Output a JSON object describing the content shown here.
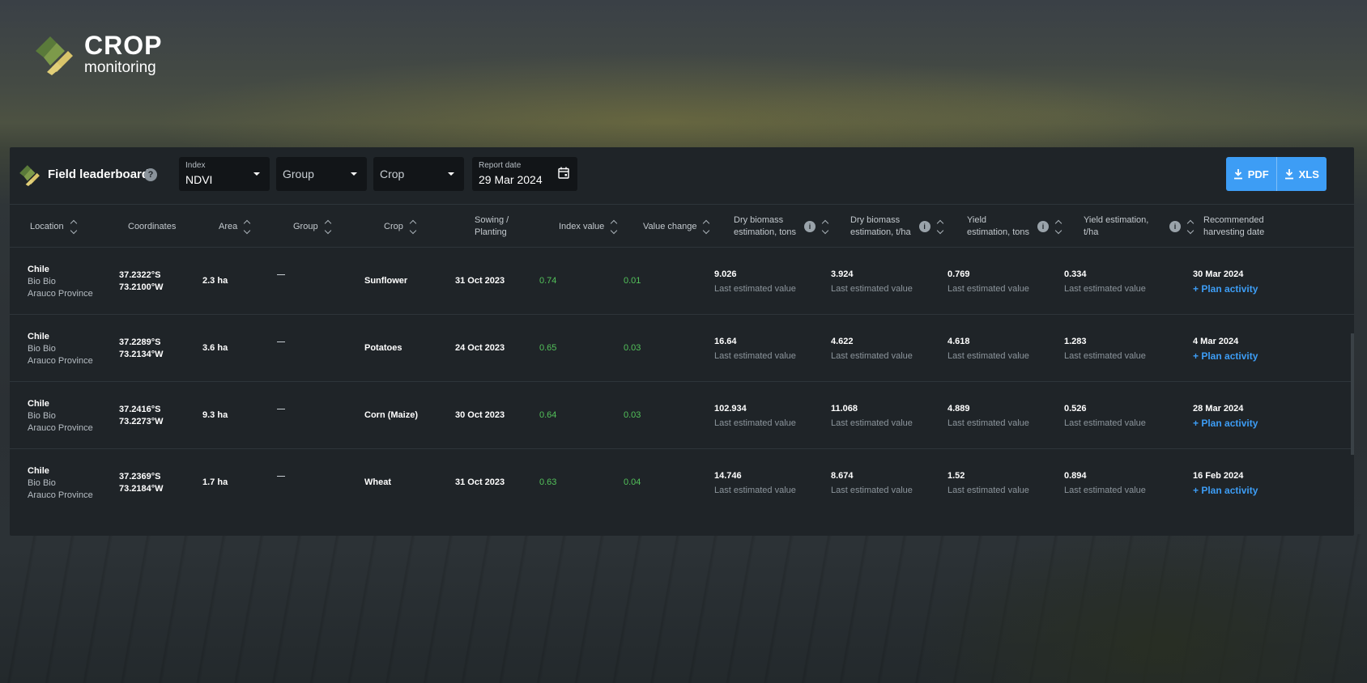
{
  "brand": {
    "title": "CROP",
    "subtitle": "monitoring"
  },
  "toolbar": {
    "title": "Field leaderboard",
    "help": "?",
    "index": {
      "label": "Index",
      "value": "NDVI"
    },
    "group": {
      "placeholder": "Group"
    },
    "crop": {
      "placeholder": "Crop"
    },
    "report_date": {
      "label": "Report date",
      "value": "29 Mar 2024"
    },
    "pdf_label": "PDF",
    "xls_label": "XLS"
  },
  "columns": {
    "location": "Location",
    "coordinates": "Coordinates",
    "area": "Area",
    "group": "Group",
    "crop": "Crop",
    "sowing_1": "Sowing /",
    "sowing_2": "Planting",
    "index_value": "Index value",
    "value_change": "Value change",
    "dry_tons_1": "Dry biomass",
    "dry_tons_2": "estimation, tons",
    "dry_tha_1": "Dry biomass",
    "dry_tha_2": "estimation, t/ha",
    "yield_tons_1": "Yield",
    "yield_tons_2": "estimation, tons",
    "yield_tha_1": "Yield estimation,",
    "yield_tha_2": "t/ha",
    "rec_1": "Recommended",
    "rec_2": "harvesting date"
  },
  "est_note": "Last estimated value",
  "plan_label": "+ Plan activity",
  "rows": [
    {
      "country": "Chile",
      "region": "Bio Bio",
      "province": "Arauco Province",
      "lat": "37.2322°S",
      "lon": "73.2100°W",
      "area": "2.3 ha",
      "crop": "Sunflower",
      "sowing": "31 Oct 2023",
      "index": "0.74",
      "change": "0.01",
      "dry_tons": "9.026",
      "dry_tha": "3.924",
      "yield_tons": "0.769",
      "yield_tha": "0.334",
      "harvest": "30 Mar 2024"
    },
    {
      "country": "Chile",
      "region": "Bio Bio",
      "province": "Arauco Province",
      "lat": "37.2289°S",
      "lon": "73.2134°W",
      "area": "3.6 ha",
      "crop": "Potatoes",
      "sowing": "24 Oct 2023",
      "index": "0.65",
      "change": "0.03",
      "dry_tons": "16.64",
      "dry_tha": "4.622",
      "yield_tons": "4.618",
      "yield_tha": "1.283",
      "harvest": "4 Mar 2024"
    },
    {
      "country": "Chile",
      "region": "Bio Bio",
      "province": "Arauco Province",
      "lat": "37.2416°S",
      "lon": "73.2273°W",
      "area": "9.3 ha",
      "crop": "Corn (Maize)",
      "sowing": "30 Oct 2023",
      "index": "0.64",
      "change": "0.03",
      "dry_tons": "102.934",
      "dry_tha": "11.068",
      "yield_tons": "4.889",
      "yield_tha": "0.526",
      "harvest": "28 Mar 2024"
    },
    {
      "country": "Chile",
      "region": "Bio Bio",
      "province": "Arauco Province",
      "lat": "37.2369°S",
      "lon": "73.2184°W",
      "area": "1.7 ha",
      "crop": "Wheat",
      "sowing": "31 Oct 2023",
      "index": "0.63",
      "change": "0.04",
      "dry_tons": "14.746",
      "dry_tha": "8.674",
      "yield_tons": "1.52",
      "yield_tha": "0.894",
      "harvest": "16 Feb 2024"
    }
  ]
}
